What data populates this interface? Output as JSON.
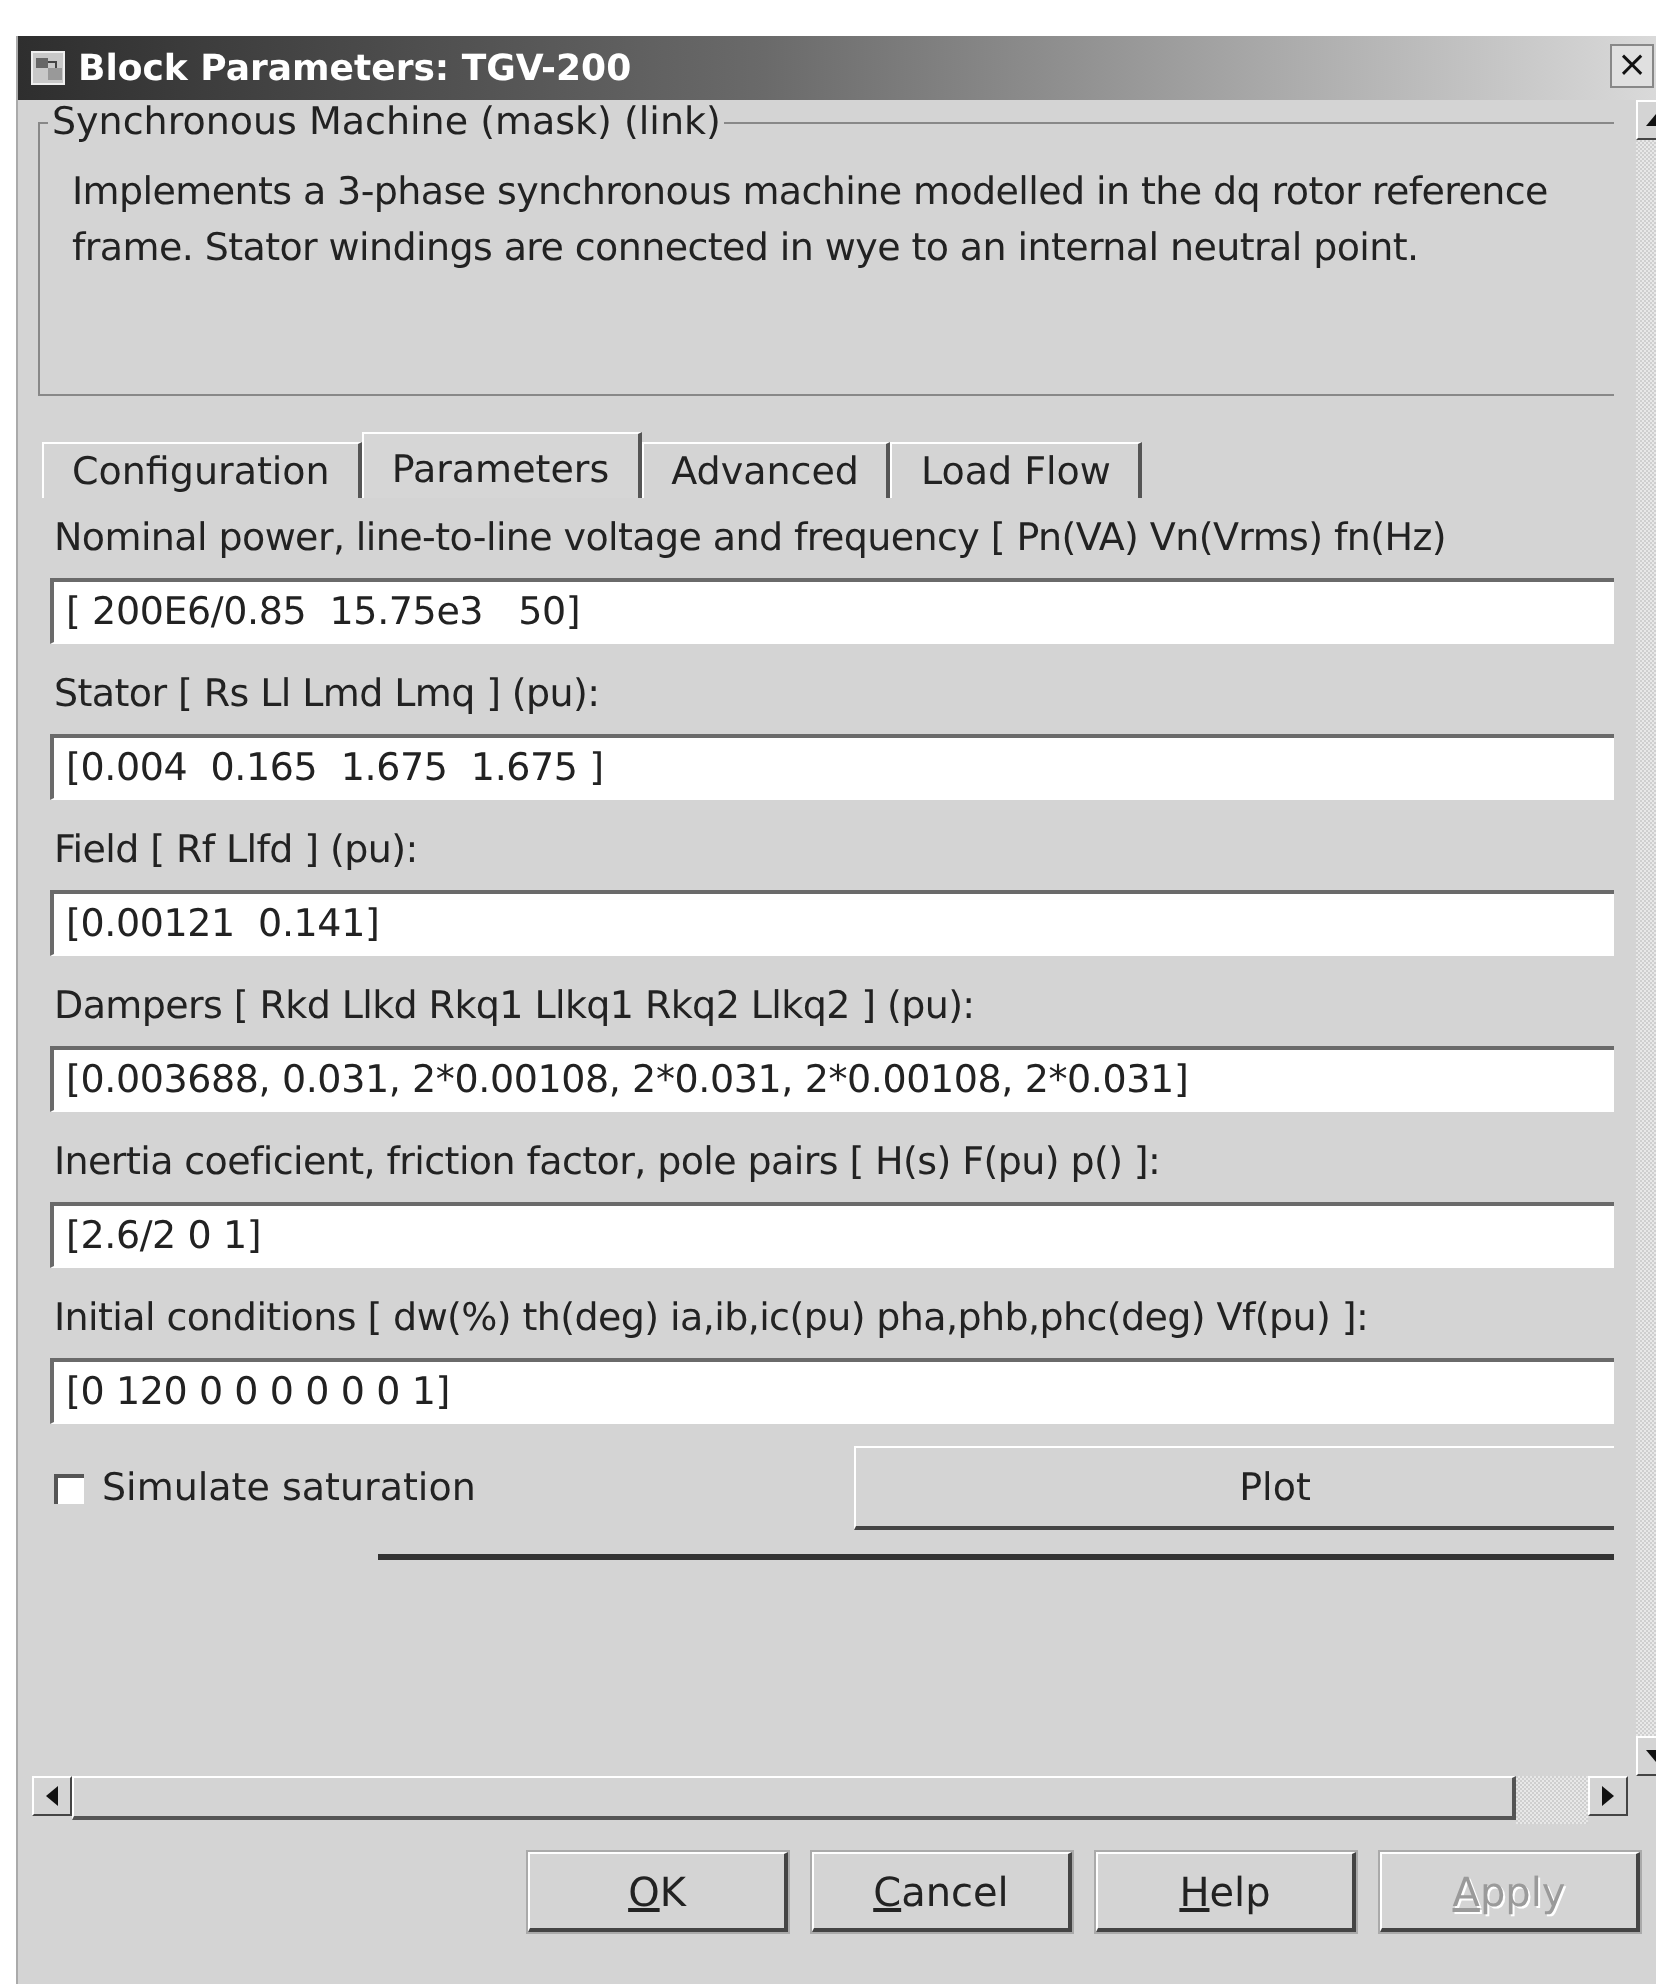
{
  "window": {
    "title": "Block Parameters: TGV-200",
    "close": "×"
  },
  "group": {
    "title": "Synchronous Machine (mask) (link)",
    "description": "Implements a 3-phase synchronous machine modelled in the dq rotor reference frame. Stator windings are connected in wye to an internal neutral point."
  },
  "tabs": [
    {
      "label": "Configuration",
      "selected": false
    },
    {
      "label": "Parameters",
      "selected": true
    },
    {
      "label": "Advanced",
      "selected": false
    },
    {
      "label": "Load Flow",
      "selected": false
    }
  ],
  "parameters": [
    {
      "label": "Nominal power, line-to-line voltage and frequency [ Pn(VA)  Vn(Vrms)  fn(Hz)",
      "value": "[ 200E6/0.85  15.75e3   50]"
    },
    {
      "label": "Stator  [ Rs  Ll  Lmd  Lmq ] (pu):",
      "value": "[0.004  0.165  1.675  1.675 ]"
    },
    {
      "label": "Field  [ Rf  Llfd ] (pu):",
      "value": "[0.00121  0.141]"
    },
    {
      "label": "Dampers  [ Rkd  Llkd  Rkq1  Llkq1  Rkq2  Llkq2 ] (pu):",
      "value": "[0.003688, 0.031, 2*0.00108, 2*0.031, 2*0.00108, 2*0.031]"
    },
    {
      "label": "Inertia coeficient, friction factor, pole pairs [ H(s)  F(pu)  p() ]:",
      "value": "[2.6/2 0 1]"
    },
    {
      "label": "Initial conditions [ dw(%)  th(deg)  ia,ib,ic(pu)  pha,phb,phc(deg)  Vf(pu) ]:",
      "value": "[0 120 0 0 0 0 0 0 1]"
    }
  ],
  "simulate_saturation": {
    "label": "Simulate saturation",
    "checked": false
  },
  "plot_button": {
    "label": "Plot"
  },
  "buttons": [
    {
      "label": "OK",
      "underline_first": true,
      "disabled": false
    },
    {
      "label": "Cancel",
      "underline_first": true,
      "disabled": false
    },
    {
      "label": "Help",
      "underline_first": true,
      "disabled": false
    },
    {
      "label": "Apply",
      "underline_first": true,
      "disabled": true
    }
  ]
}
